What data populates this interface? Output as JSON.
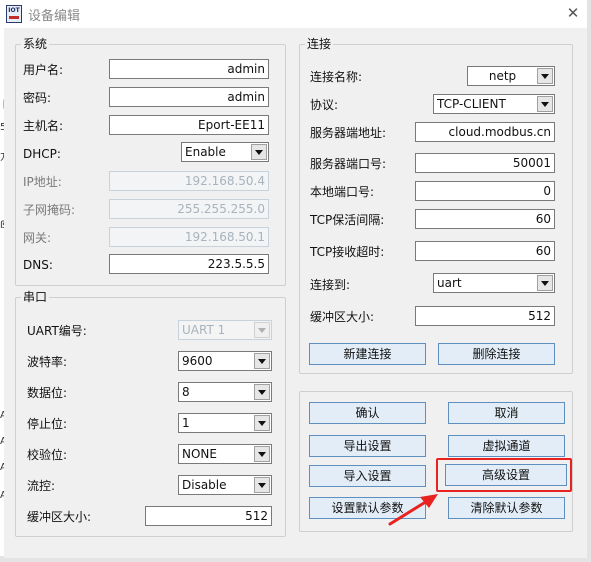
{
  "window": {
    "title": "设备编辑",
    "logo_text": "IOT",
    "close_glyph": "✕"
  },
  "background_fragments": [
    "卜",
    "5",
    "方",
    "ß",
    "A",
    "A",
    "A",
    "A"
  ],
  "system_group": {
    "title": "系统",
    "fields": [
      {
        "label": "用户名:",
        "value": "admin",
        "disabled": false
      },
      {
        "label": "密码:",
        "value": "admin",
        "disabled": false
      },
      {
        "label": "主机名:",
        "value": "Eport-EE11",
        "disabled": false
      },
      {
        "label": "DHCP:",
        "value": "Enable",
        "type": "combo"
      },
      {
        "label": "IP地址:",
        "value": "192.168.50.4",
        "disabled": true
      },
      {
        "label": "子网掩码:",
        "value": "255.255.255.0",
        "disabled": true
      },
      {
        "label": "网关:",
        "value": "192.168.50.1",
        "disabled": true
      },
      {
        "label": "DNS:",
        "value": "223.5.5.5",
        "disabled": false
      }
    ]
  },
  "serial_group": {
    "title": "串口",
    "fields": [
      {
        "label": "UART编号:",
        "value": "UART 1",
        "disabled": true
      },
      {
        "label": "波特率:",
        "value": "9600"
      },
      {
        "label": "数据位:",
        "value": "8"
      },
      {
        "label": "停止位:",
        "value": "1"
      },
      {
        "label": "校验位:",
        "value": "NONE"
      },
      {
        "label": "流控:",
        "value": "Disable"
      },
      {
        "label": "缓冲区大小:",
        "value": "512"
      }
    ]
  },
  "connection_group": {
    "title": "连接",
    "fields": [
      {
        "label": "连接名称:",
        "value": "netp",
        "type": "combo"
      },
      {
        "label": "协议:",
        "value": "TCP-CLIENT",
        "type": "combo"
      },
      {
        "label": "服务器端地址:",
        "value": "cloud.modbus.cn"
      },
      {
        "label": "服务器端口号:",
        "value": "50001"
      },
      {
        "label": "本地端口号:",
        "value": "0"
      },
      {
        "label": "TCP保活间隔:",
        "value": "60"
      },
      {
        "label": "TCP接收超时:",
        "value": "60"
      },
      {
        "label": "连接到:",
        "value": "uart",
        "type": "combo"
      },
      {
        "label": "缓冲区大小:",
        "value": "512"
      }
    ],
    "new_connection_button": "新建连接",
    "delete_connection_button": "删除连接"
  },
  "actions": {
    "confirm": "确认",
    "cancel": "取消",
    "export_settings": "导出设置",
    "virtual_channel": "虚拟通道",
    "import_settings": "导入设置",
    "advanced_settings": "高级设置",
    "set_default_params": "设置默认参数",
    "clear_default_params": "清除默认参数"
  },
  "annotation": {
    "highlight_color": "#e8231f",
    "highlighted_target": "高级设置"
  },
  "colors": {
    "button_fill": "#e2edf8",
    "button_border": "#5f8fbf",
    "dialog_background": "#f0f0f0",
    "disabled_text": "#a9b3bd"
  }
}
